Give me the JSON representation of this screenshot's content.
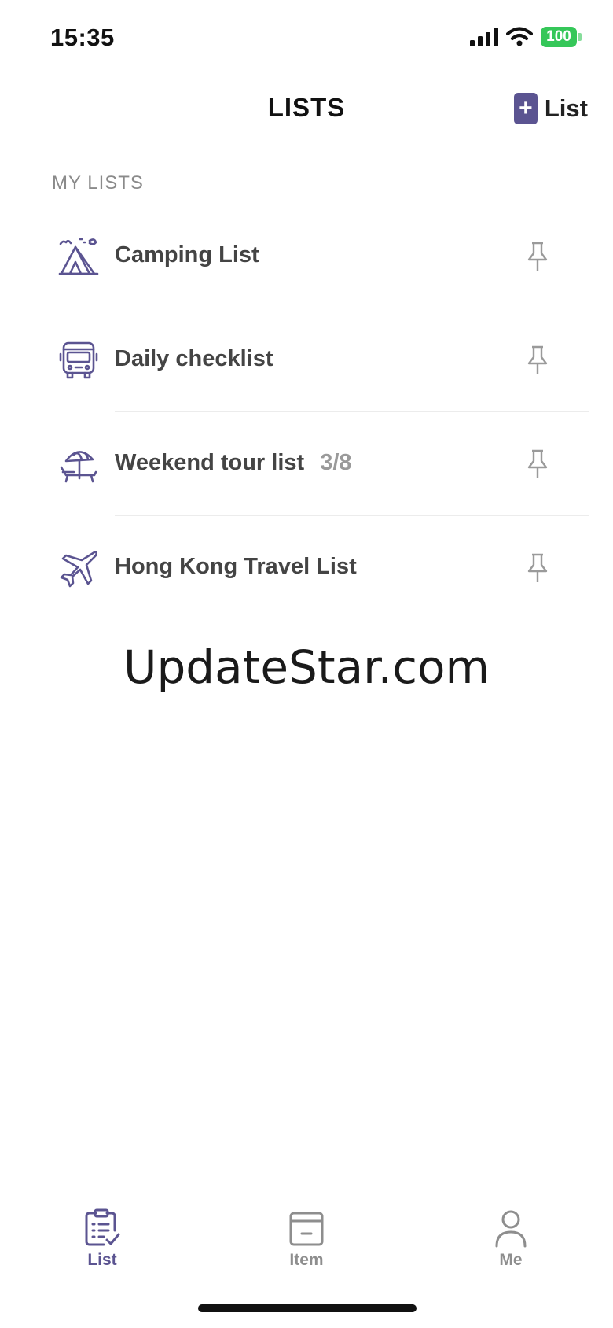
{
  "status_bar": {
    "time": "15:35",
    "battery": "100"
  },
  "nav": {
    "title": "LISTS",
    "add_button_label": "List"
  },
  "section": {
    "header": "MY LISTS"
  },
  "lists": [
    {
      "icon": "tent-icon",
      "label": "Camping List",
      "count": ""
    },
    {
      "icon": "bus-icon",
      "label": "Daily checklist",
      "count": ""
    },
    {
      "icon": "beach-umbrella-icon",
      "label": "Weekend tour list",
      "count": "3/8"
    },
    {
      "icon": "airplane-icon",
      "label": "Hong Kong Travel List",
      "count": ""
    }
  ],
  "watermark": "UpdateStar.com",
  "tabs": [
    {
      "label": "List",
      "active": true
    },
    {
      "label": "Item",
      "active": false
    },
    {
      "label": "Me",
      "active": false
    }
  ],
  "colors": {
    "accent": "#5b5491",
    "inactive": "#8e8e8e",
    "battery": "#35c759"
  }
}
